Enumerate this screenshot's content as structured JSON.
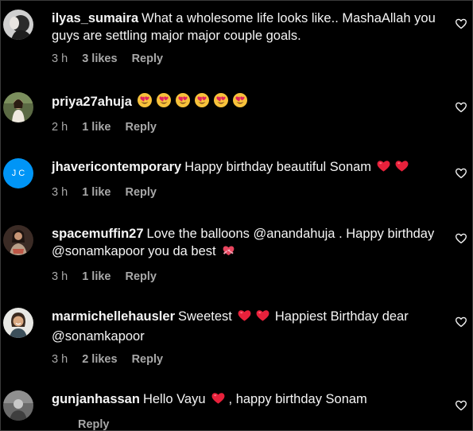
{
  "comments": [
    {
      "username": "ilyas_sumaira",
      "text": "What a wholesome life looks like.. MashaAllah you guys are settling major major couple goals.",
      "time": "3 h",
      "likes": "3 likes",
      "reply": "Reply",
      "avatar_icon": "avatar-photo",
      "like_icon": "heart-outline-icon"
    },
    {
      "username": "priya27ahuja",
      "text": "",
      "emojis": [
        "smiling-face-with-heart-eyes",
        "smiling-face-with-heart-eyes",
        "smiling-face-with-heart-eyes",
        "smiling-face-with-heart-eyes",
        "smiling-face-with-heart-eyes",
        "smiling-face-with-heart-eyes"
      ],
      "time": "2 h",
      "likes": "1 like",
      "reply": "Reply",
      "avatar_icon": "avatar-photo",
      "like_icon": "heart-outline-icon"
    },
    {
      "username": "jhavericontemporary",
      "text": "Happy birthday beautiful Sonam",
      "emojis": [
        "red-heart",
        "red-heart"
      ],
      "time": "3 h",
      "likes": "1 like",
      "reply": "Reply",
      "avatar_initials": "J C",
      "avatar_icon": "avatar-initials",
      "like_icon": "heart-outline-icon"
    },
    {
      "username": "spacemuffin27",
      "text_before": "Love the balloons @anandahuja . Happy birthday @sonamkapoor you da best",
      "emojis": [
        "heart-with-ribbon"
      ],
      "time": "3 h",
      "likes": "1 like",
      "reply": "Reply",
      "avatar_icon": "avatar-photo",
      "like_icon": "heart-outline-icon"
    },
    {
      "username": "marmichellehausler",
      "text_part1": "Sweetest",
      "text_part2": "Happiest Birthday dear @sonamkapoor",
      "emojis": [
        "red-heart",
        "red-heart"
      ],
      "time": "3 h",
      "likes": "2 likes",
      "reply": "Reply",
      "avatar_icon": "avatar-photo",
      "like_icon": "heart-outline-icon"
    },
    {
      "username": "gunjanhassan",
      "text_part1": "Hello Vayu",
      "text_part2": ", happy birthday Sonam",
      "emojis": [
        "red-heart"
      ],
      "reply": "Reply",
      "avatar_icon": "avatar-photo",
      "like_icon": "heart-outline-icon"
    }
  ],
  "colors": {
    "background": "#000000",
    "text": "#f5f5f5",
    "meta": "#a8a8a8",
    "avatar_initials_bg": "#0095f6",
    "heart_red": "#ff3040"
  }
}
